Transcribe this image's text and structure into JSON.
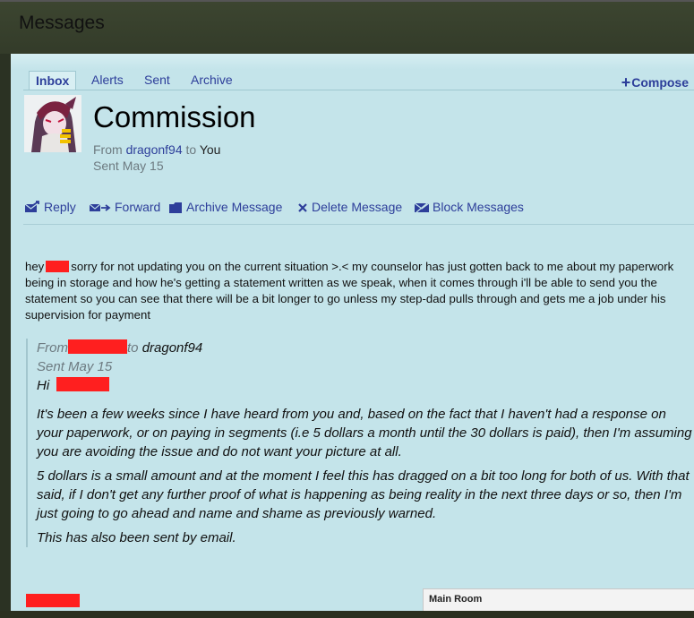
{
  "window": {
    "title": "Messages"
  },
  "tabs": [
    {
      "label": "Inbox",
      "active": true
    },
    {
      "label": "Alerts"
    },
    {
      "label": "Sent"
    },
    {
      "label": "Archive"
    }
  ],
  "compose": {
    "icon": "plus-icon",
    "label": "Compose"
  },
  "message": {
    "subject": "Commission",
    "from_prefix": "From",
    "from_user": "dragonf94",
    "to_prefix": "to",
    "to_user": "You",
    "sent": "Sent May 15"
  },
  "actions": [
    {
      "label": "Reply",
      "icon": "reply-icon"
    },
    {
      "label": "Forward",
      "icon": "forward-icon"
    },
    {
      "label": "Archive Message",
      "icon": "folder-icon"
    },
    {
      "label": "Delete Message",
      "icon": "close-icon"
    },
    {
      "label": "Block Messages",
      "icon": "block-mail-icon"
    }
  ],
  "body": {
    "greeting": "hey",
    "text": "sorry for not updating you on the current situation >.< my counselor has just gotten back to me about my paperwork being in storage and how he's getting a statement written as we speak, when it comes through i'll be able to send you the statement so you can see that there will be a bit longer to go unless my step-dad pulls through and gets me a job under his supervision for payment"
  },
  "quote": {
    "from_prefix": "From",
    "to_prefix": "to",
    "to_user": "dragonf94",
    "sent": "Sent May 15",
    "greeting": "Hi",
    "paragraphs": [
      "It's been a few weeks since I have heard from you and, based on the fact that I haven't had a response on your paperwork, or on paying in segments (i.e 5 dollars a month until the 30 dollars is paid), then I'm assuming you are avoiding the issue and do not want your picture at all.",
      "5 dollars is a small amount and at the moment I feel this has dragged on a bit too long for both of us. With that said, if I don't get any further proof of what is happening as being reality in the next three days or so, then I'm just going to go ahead and name and shame as previously warned.",
      "This has also been sent by email."
    ]
  },
  "chat": {
    "label": "Main Room"
  },
  "colors": {
    "accent": "#2d3e9a",
    "panel": "#c4e4ea",
    "redaction": "#ff1f1f"
  }
}
